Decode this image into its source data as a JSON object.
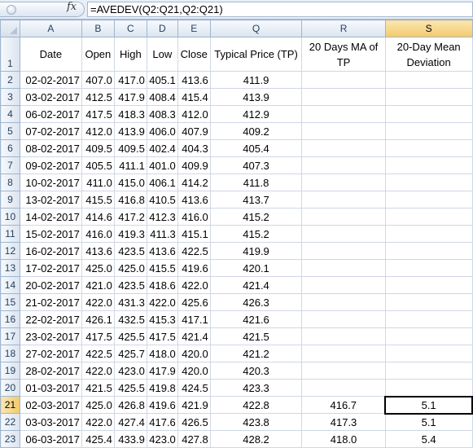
{
  "formula_bar": {
    "fx_label": "fx",
    "formula": "=AVEDEV(Q2:Q21,Q2:Q21)"
  },
  "columns": [
    "A",
    "B",
    "C",
    "D",
    "E",
    "Q",
    "R",
    "S"
  ],
  "header_row": {
    "row_number": "1",
    "cells": [
      "Date",
      "Open",
      "High",
      "Low",
      "Close",
      "Typical Price (TP)",
      "20 Days MA of TP",
      "20-Day Mean Deviation"
    ]
  },
  "rows": [
    {
      "n": "2",
      "date": "02-02-2017",
      "open": "407.0",
      "high": "417.0",
      "low": "405.1",
      "close": "413.6",
      "tp": "411.9",
      "ma": "",
      "md": ""
    },
    {
      "n": "3",
      "date": "03-02-2017",
      "open": "412.5",
      "high": "417.9",
      "low": "408.4",
      "close": "415.4",
      "tp": "413.9",
      "ma": "",
      "md": ""
    },
    {
      "n": "4",
      "date": "06-02-2017",
      "open": "417.5",
      "high": "418.3",
      "low": "408.3",
      "close": "412.0",
      "tp": "412.9",
      "ma": "",
      "md": ""
    },
    {
      "n": "5",
      "date": "07-02-2017",
      "open": "412.0",
      "high": "413.9",
      "low": "406.0",
      "close": "407.9",
      "tp": "409.2",
      "ma": "",
      "md": ""
    },
    {
      "n": "6",
      "date": "08-02-2017",
      "open": "409.5",
      "high": "409.5",
      "low": "402.4",
      "close": "404.3",
      "tp": "405.4",
      "ma": "",
      "md": ""
    },
    {
      "n": "7",
      "date": "09-02-2017",
      "open": "405.5",
      "high": "411.1",
      "low": "401.0",
      "close": "409.9",
      "tp": "407.3",
      "ma": "",
      "md": ""
    },
    {
      "n": "8",
      "date": "10-02-2017",
      "open": "411.0",
      "high": "415.0",
      "low": "406.1",
      "close": "414.2",
      "tp": "411.8",
      "ma": "",
      "md": ""
    },
    {
      "n": "9",
      "date": "13-02-2017",
      "open": "415.5",
      "high": "416.8",
      "low": "410.5",
      "close": "413.6",
      "tp": "413.7",
      "ma": "",
      "md": ""
    },
    {
      "n": "10",
      "date": "14-02-2017",
      "open": "414.6",
      "high": "417.2",
      "low": "412.3",
      "close": "416.0",
      "tp": "415.2",
      "ma": "",
      "md": ""
    },
    {
      "n": "11",
      "date": "15-02-2017",
      "open": "416.0",
      "high": "419.3",
      "low": "411.3",
      "close": "415.1",
      "tp": "415.2",
      "ma": "",
      "md": ""
    },
    {
      "n": "12",
      "date": "16-02-2017",
      "open": "413.6",
      "high": "423.5",
      "low": "413.6",
      "close": "422.5",
      "tp": "419.9",
      "ma": "",
      "md": ""
    },
    {
      "n": "13",
      "date": "17-02-2017",
      "open": "425.0",
      "high": "425.0",
      "low": "415.5",
      "close": "419.6",
      "tp": "420.1",
      "ma": "",
      "md": ""
    },
    {
      "n": "14",
      "date": "20-02-2017",
      "open": "421.0",
      "high": "423.5",
      "low": "418.6",
      "close": "422.0",
      "tp": "421.4",
      "ma": "",
      "md": ""
    },
    {
      "n": "15",
      "date": "21-02-2017",
      "open": "422.0",
      "high": "431.3",
      "low": "422.0",
      "close": "425.6",
      "tp": "426.3",
      "ma": "",
      "md": ""
    },
    {
      "n": "16",
      "date": "22-02-2017",
      "open": "426.1",
      "high": "432.5",
      "low": "415.3",
      "close": "417.1",
      "tp": "421.6",
      "ma": "",
      "md": ""
    },
    {
      "n": "17",
      "date": "23-02-2017",
      "open": "417.5",
      "high": "425.5",
      "low": "417.5",
      "close": "421.4",
      "tp": "421.5",
      "ma": "",
      "md": ""
    },
    {
      "n": "18",
      "date": "27-02-2017",
      "open": "422.5",
      "high": "425.7",
      "low": "418.0",
      "close": "420.0",
      "tp": "421.2",
      "ma": "",
      "md": ""
    },
    {
      "n": "19",
      "date": "28-02-2017",
      "open": "422.0",
      "high": "423.0",
      "low": "417.9",
      "close": "420.0",
      "tp": "420.3",
      "ma": "",
      "md": ""
    },
    {
      "n": "20",
      "date": "01-03-2017",
      "open": "421.5",
      "high": "425.5",
      "low": "419.8",
      "close": "424.5",
      "tp": "423.3",
      "ma": "",
      "md": ""
    },
    {
      "n": "21",
      "date": "02-03-2017",
      "open": "425.0",
      "high": "426.8",
      "low": "419.6",
      "close": "421.9",
      "tp": "422.8",
      "ma": "416.7",
      "md": "5.1"
    },
    {
      "n": "22",
      "date": "03-03-2017",
      "open": "422.0",
      "high": "427.4",
      "low": "417.6",
      "close": "426.5",
      "tp": "423.8",
      "ma": "417.3",
      "md": "5.1"
    },
    {
      "n": "23",
      "date": "06-03-2017",
      "open": "425.4",
      "high": "433.9",
      "low": "423.0",
      "close": "427.8",
      "tp": "428.2",
      "ma": "418.0",
      "md": "5.4"
    }
  ],
  "selection": {
    "column": "S",
    "row": "21"
  }
}
